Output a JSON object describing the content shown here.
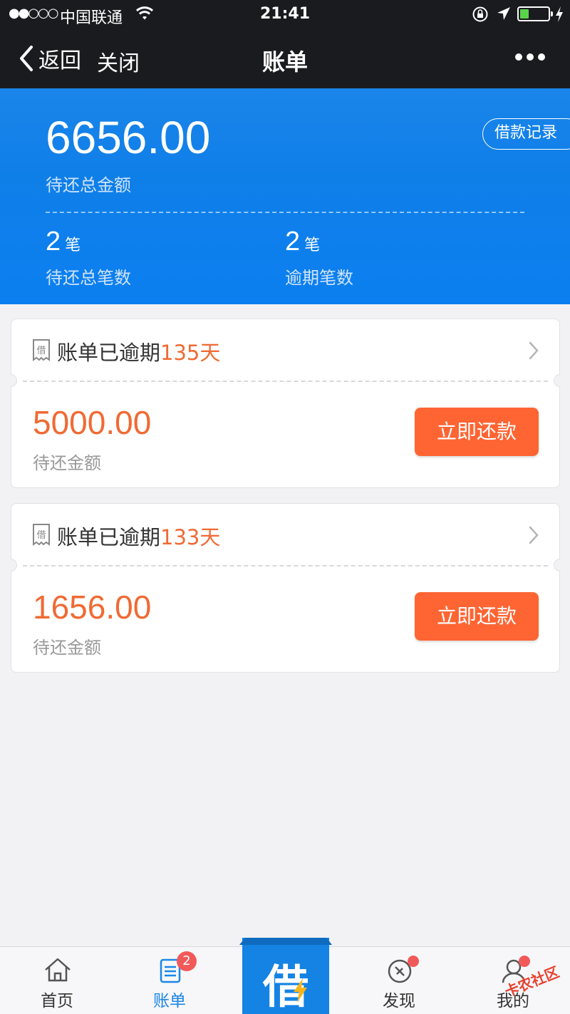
{
  "status_bar": {
    "signal": "●●○○○",
    "carrier": "中国联通",
    "time": "21:41"
  },
  "nav": {
    "back_label": "返回",
    "close_label": "关闭",
    "title": "账单"
  },
  "summary": {
    "total_amount": "6656.00",
    "total_label": "待还总金额",
    "record_button": "借款记录",
    "pending_count": "2",
    "pending_unit": "笔",
    "pending_label": "待还总笔数",
    "overdue_count": "2",
    "overdue_unit": "笔",
    "overdue_label": "逾期笔数"
  },
  "bills": [
    {
      "icon_char": "借",
      "status_text": "账单已逾期",
      "days": "135天",
      "amount": "5000.00",
      "amount_label": "待还金额",
      "pay_button": "立即还款"
    },
    {
      "icon_char": "借",
      "status_text": "账单已逾期",
      "days": "133天",
      "amount": "1656.00",
      "amount_label": "待还金额",
      "pay_button": "立即还款"
    }
  ],
  "tab_bar": {
    "tabs": [
      {
        "label": "首页",
        "icon": "home-icon"
      },
      {
        "label": "账单",
        "icon": "bill-list-icon",
        "badge": "2"
      },
      {
        "label": "发现",
        "icon": "compass-icon"
      },
      {
        "label": "我的",
        "icon": "user-icon"
      }
    ],
    "center_button": "借",
    "watermark": "卡农社区"
  },
  "colors": {
    "nav_bg": "#1a1b1f",
    "header_blue": "#1483e4",
    "accent_orange": "#f06a34",
    "pay_button": "#ff6433",
    "badge_red": "#f25a5a",
    "active_tab": "#1a86e8"
  }
}
